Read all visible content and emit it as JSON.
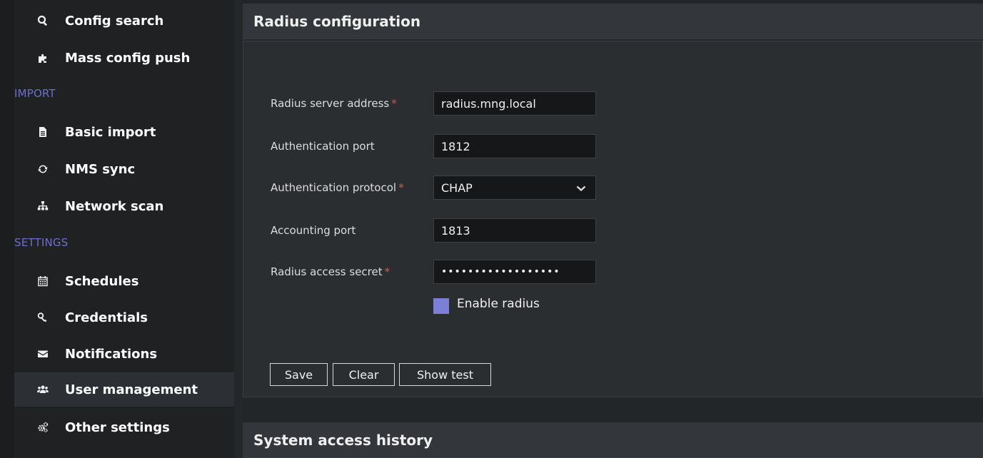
{
  "sidebar": {
    "items": [
      {
        "label": "Config search",
        "icon": "search-icon"
      },
      {
        "label": "Mass config push",
        "icon": "puzzle-icon"
      },
      {
        "label": "Basic import",
        "icon": "file-icon"
      },
      {
        "label": "NMS sync",
        "icon": "sync-icon"
      },
      {
        "label": "Network scan",
        "icon": "sitemap-icon"
      },
      {
        "label": "Schedules",
        "icon": "calendar-icon"
      },
      {
        "label": "Credentials",
        "icon": "key-icon"
      },
      {
        "label": "Notifications",
        "icon": "envelope-icon"
      },
      {
        "label": "User management",
        "icon": "users-icon",
        "active": true
      },
      {
        "label": "Other settings",
        "icon": "cogs-icon"
      }
    ],
    "sections": {
      "import": "IMPORT",
      "settings": "SETTINGS"
    }
  },
  "radius_panel": {
    "title": "Radius configuration",
    "fields": {
      "server_address": {
        "label": "Radius server address",
        "value": "radius.mng.local",
        "required": true
      },
      "auth_port": {
        "label": "Authentication port",
        "value": "1812"
      },
      "auth_protocol": {
        "label": "Authentication protocol",
        "value": "CHAP",
        "required": true
      },
      "accounting_port": {
        "label": "Accounting port",
        "value": "1813"
      },
      "access_secret": {
        "label": "Radius access secret",
        "value": "••••••••••••••••••",
        "required": true
      }
    },
    "required_marker": "*",
    "enable_label": "Enable radius",
    "buttons": {
      "save": "Save",
      "clear": "Clear",
      "show_test": "Show test"
    }
  },
  "history_panel": {
    "title": "System access history"
  },
  "colors": {
    "accent": "#7b80d6",
    "section_label": "#6b6fcf",
    "required": "#e05252"
  }
}
